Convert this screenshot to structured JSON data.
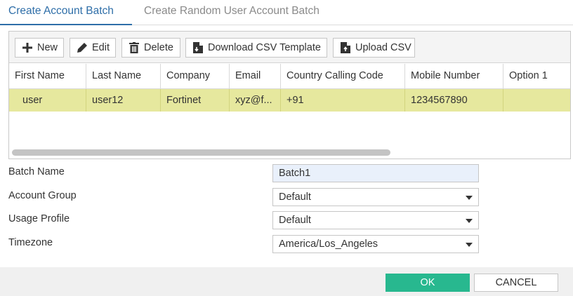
{
  "tabs": [
    {
      "label": "Create Account Batch",
      "active": true
    },
    {
      "label": "Create Random User Account Batch",
      "active": false
    }
  ],
  "toolbar": {
    "new_label": "New",
    "edit_label": "Edit",
    "delete_label": "Delete",
    "download_label": "Download CSV Template",
    "upload_label": "Upload CSV"
  },
  "table": {
    "columns": [
      "First Name",
      "Last Name",
      "Company",
      "Email",
      "Country Calling Code",
      "Mobile Number",
      "Option 1"
    ],
    "rows": [
      [
        "user",
        "user12",
        "Fortinet",
        "xyz@f...",
        "+91",
        "1234567890",
        ""
      ]
    ],
    "selected_row_color": "#e6e89e"
  },
  "form": {
    "batch_name_label": "Batch Name",
    "batch_name_value": "Batch1",
    "account_group_label": "Account Group",
    "account_group_value": "Default",
    "usage_profile_label": "Usage Profile",
    "usage_profile_value": "Default",
    "timezone_label": "Timezone",
    "timezone_value": "America/Los_Angeles"
  },
  "footer": {
    "ok_label": "OK",
    "cancel_label": "CANCEL",
    "ok_color": "#28b88f"
  },
  "icons": {
    "new": "plus-icon",
    "edit": "pencil-icon",
    "delete": "trash-icon",
    "download": "file-download-icon",
    "upload": "file-upload-icon",
    "select": "caret-down-icon"
  }
}
